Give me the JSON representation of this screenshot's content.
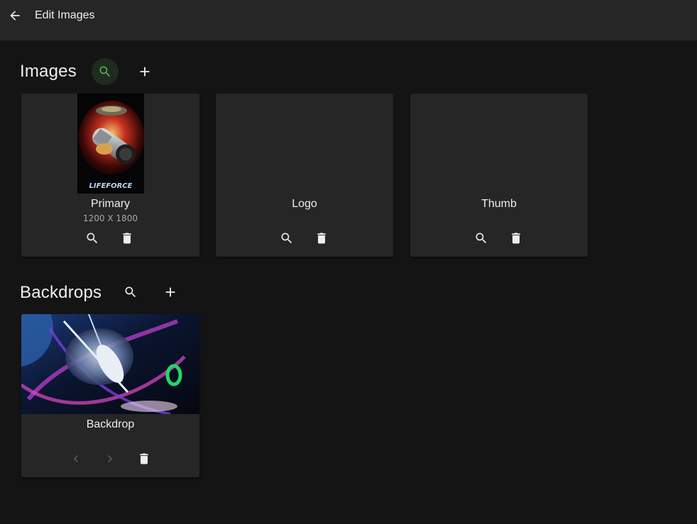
{
  "header": {
    "title": "Edit Images"
  },
  "images_section": {
    "title": "Images",
    "cards": [
      {
        "label": "Primary",
        "size": "1200 X 1800",
        "poster_text": "LIFEFORCE"
      },
      {
        "label": "Logo"
      },
      {
        "label": "Thumb"
      }
    ]
  },
  "backdrops_section": {
    "title": "Backdrops",
    "cards": [
      {
        "label": "Backdrop"
      }
    ]
  },
  "colors": {
    "background": "#141414",
    "header": "#262626",
    "card": "#262626",
    "accent": "#52b54b"
  },
  "icons": [
    "arrow-back-icon",
    "search-icon",
    "add-icon",
    "delete-icon",
    "chevron-left-icon",
    "chevron-right-icon"
  ]
}
